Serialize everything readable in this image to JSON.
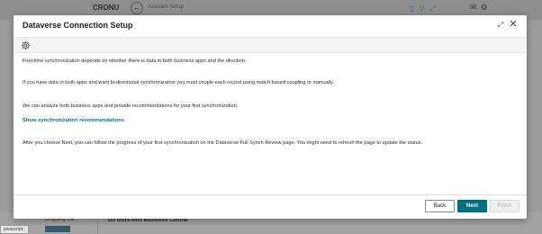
{
  "background": {
    "company": "CRONU",
    "breadcrumb": "Assisted Setup",
    "ongoing": "Ongoing Sa",
    "do_more": "Do more with Business Central",
    "status_bar": "javascript:;"
  },
  "dialog": {
    "title": "Dataverse Connection Setup",
    "paragraphs": [
      "First-time synchronization depends on whether there is data in both business apps and the direction.",
      "If you have data in both apps and want bi-directional synchronization you must couple each record using match-based coupling or manually.",
      "We can analyze both business apps and provide recommendations for your first synchronization.",
      "After you choose Next, you can follow the progress of your first synchronization on the Dataverse Full Synch Review page. You might need to refresh the page to update the status."
    ],
    "link": "Show synchronization recommendations",
    "buttons": {
      "back": "Back",
      "next": "Next",
      "finish": "Finish"
    }
  },
  "colors": {
    "accent": "#00707f",
    "link": "#1b6e8a"
  },
  "icons": [
    "gear-icon",
    "expand-icon",
    "close-icon",
    "back-arrow-icon"
  ]
}
